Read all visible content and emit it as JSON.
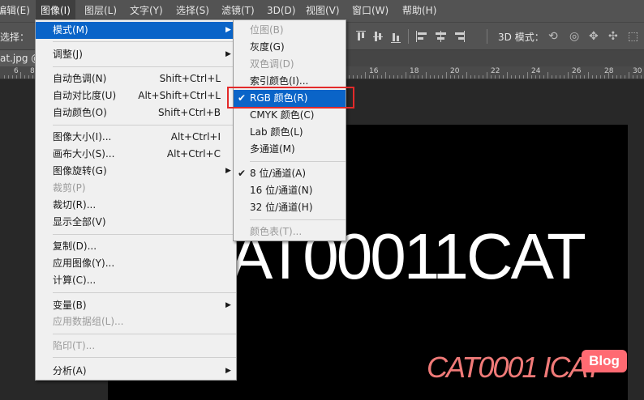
{
  "menubar": {
    "items": [
      "编辑(E)",
      "图像(I)",
      "图层(L)",
      "文字(Y)",
      "选择(S)",
      "滤镜(T)",
      "3D(D)",
      "视图(V)",
      "窗口(W)",
      "帮助(H)"
    ],
    "partial_first": "编辑(E)"
  },
  "options_bar": {
    "label": "选择：",
    "mode_3d_label": "3D 模式："
  },
  "tab": {
    "title": "at.jpg @"
  },
  "ruler": {
    "labels": [
      "6",
      "8",
      "16",
      "18",
      "20",
      "22",
      "24",
      "26",
      "28",
      "30"
    ]
  },
  "canvas": {
    "main_text": "AT00011CAT",
    "watermark_text": "CAT0001 ICAT",
    "badge_text": "Blog"
  },
  "image_menu": {
    "items": [
      {
        "label": "模式(M)",
        "shortcut": "",
        "submenu": true,
        "highlight": true
      },
      {
        "label": "调整(J)",
        "shortcut": "",
        "submenu": true
      },
      {
        "label": "自动色调(N)",
        "shortcut": "Shift+Ctrl+L"
      },
      {
        "label": "自动对比度(U)",
        "shortcut": "Alt+Shift+Ctrl+L"
      },
      {
        "label": "自动颜色(O)",
        "shortcut": "Shift+Ctrl+B"
      },
      {
        "label": "图像大小(I)...",
        "shortcut": "Alt+Ctrl+I"
      },
      {
        "label": "画布大小(S)...",
        "shortcut": "Alt+Ctrl+C"
      },
      {
        "label": "图像旋转(G)",
        "shortcut": "",
        "submenu": true
      },
      {
        "label": "裁剪(P)",
        "shortcut": "",
        "disabled": true
      },
      {
        "label": "裁切(R)...",
        "shortcut": ""
      },
      {
        "label": "显示全部(V)",
        "shortcut": ""
      },
      {
        "label": "复制(D)...",
        "shortcut": ""
      },
      {
        "label": "应用图像(Y)...",
        "shortcut": ""
      },
      {
        "label": "计算(C)...",
        "shortcut": ""
      },
      {
        "label": "变量(B)",
        "shortcut": "",
        "submenu": true
      },
      {
        "label": "应用数据组(L)...",
        "shortcut": "",
        "disabled": true
      },
      {
        "label": "陷印(T)...",
        "shortcut": "",
        "disabled": true
      },
      {
        "label": "分析(A)",
        "shortcut": "",
        "submenu": true
      }
    ]
  },
  "mode_menu": {
    "items": [
      {
        "label": "位图(B)",
        "disabled": true
      },
      {
        "label": "灰度(G)"
      },
      {
        "label": "双色调(D)",
        "disabled": true
      },
      {
        "label": "索引颜色(I)..."
      },
      {
        "label": "RGB 颜色(R)",
        "checked": true,
        "highlight": true
      },
      {
        "label": "CMYK 颜色(C)"
      },
      {
        "label": "Lab 颜色(L)"
      },
      {
        "label": "多通道(M)"
      },
      {
        "label": "8 位/通道(A)",
        "checked": true
      },
      {
        "label": "16 位/通道(N)"
      },
      {
        "label": "32 位/通道(H)"
      },
      {
        "label": "颜色表(T)...",
        "disabled": true
      }
    ],
    "check_mark": "✔"
  },
  "colors": {
    "highlight": "#0a64c8",
    "red_box": "#e32a2a",
    "watermark": "#f07a78",
    "badge": "#ff6a72"
  }
}
